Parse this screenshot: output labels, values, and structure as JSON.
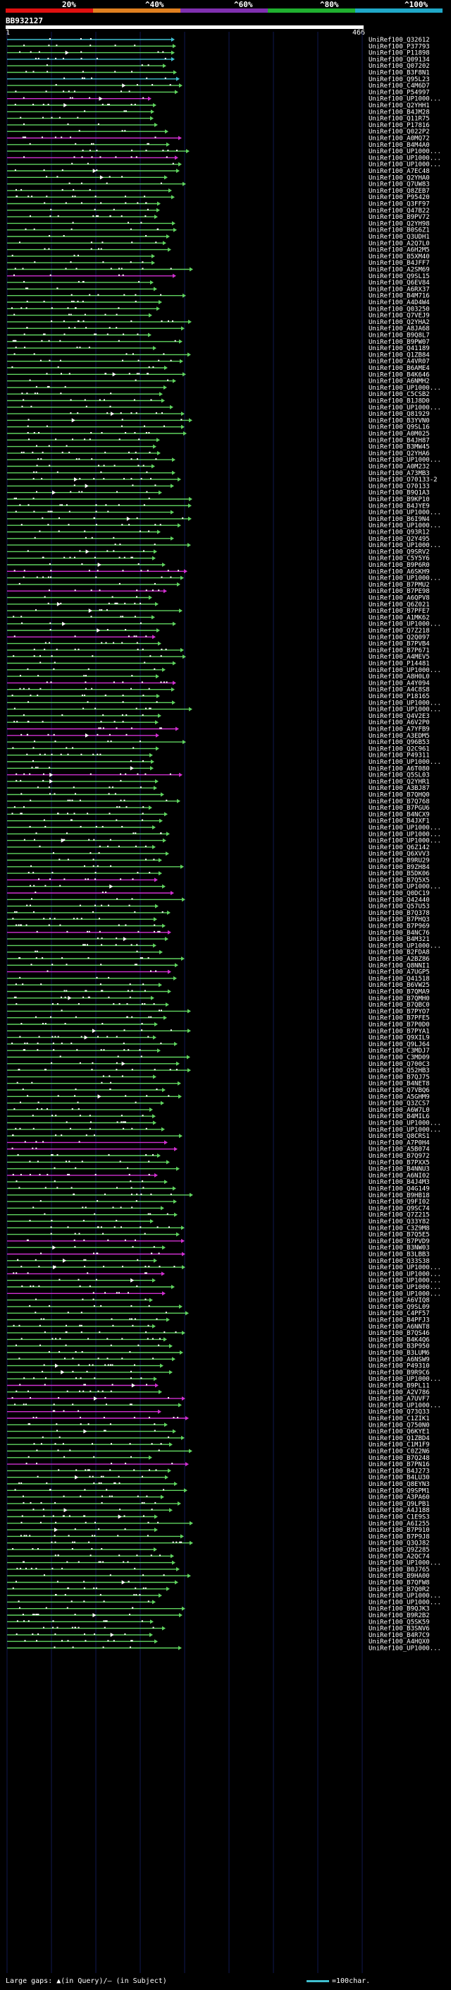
{
  "legend": {
    "labels": [
      "20%",
      "^40%",
      "^60%",
      "^80%",
      "^100%"
    ],
    "colors": [
      "#e01010",
      "#e08020",
      "#8030b0",
      "#20b030",
      "#20a8c8"
    ]
  },
  "query": {
    "id": "BB932127",
    "start": "1",
    "end": "466"
  },
  "hits": [
    "UniRef100_Q32612",
    "UniRef100_P37793",
    "UniRef100_P11898",
    "UniRef100_Q09134",
    "UniRef100_Q07202",
    "UniRef100_B3F8N1",
    "UniRef100_Q95L23",
    "UniRef100_C4M6D7",
    "UniRef100_P54997",
    "UniRef100_UP1000...",
    "UniRef100_Q2YHH1",
    "UniRef100_B4JM28",
    "UniRef100_Q11R75",
    "UniRef100_P17816",
    "UniRef100_Q022P2",
    "UniRef100_A0MQ72",
    "UniRef100_B4M4A0",
    "UniRef100_UP1000...",
    "UniRef100_UP1000...",
    "UniRef100_UP1000...",
    "UniRef100_A7EC48",
    "UniRef100_Q2YHA0",
    "UniRef100_Q7UW83",
    "UniRef100_Q8ZEB7",
    "UniRef100_P95420",
    "UniRef100_Q3FF97",
    "UniRef100_Q47B22",
    "UniRef100_B9PV72",
    "UniRef100_Q2YH98",
    "UniRef100_B0S6Z1",
    "UniRef100_Q3UDH1",
    "UniRef100_A2Q7L0",
    "UniRef100_A6H2M5",
    "UniRef100_B5XM40",
    "UniRef100_B4JFF7",
    "UniRef100_A2SM69",
    "UniRef100_Q9SL15",
    "UniRef100_Q6EV84",
    "UniRef100_A6RX37",
    "UniRef100_B4M716",
    "UniRef100_A4D4W4",
    "UniRef100_Q03250",
    "UniRef100_Q7VEJ9",
    "UniRef100_Q2YHA2",
    "UniRef100_A8JA68",
    "UniRef100_B9Q8L7",
    "UniRef100_B9PW07",
    "UniRef100_Q41189",
    "UniRef100_Q1ZB84",
    "UniRef100_A4VR07",
    "UniRef100_B6AME4",
    "UniRef100_B4K646",
    "UniRef100_A6NMH2",
    "UniRef100_UP1000...",
    "UniRef100_C5CSB2",
    "UniRef100_B1J8D0",
    "UniRef100_UP1000...",
    "UniRef100_Q81929",
    "UniRef100_B3YVN0",
    "UniRef100_Q9SL16",
    "UniRef100_A0M025",
    "UniRef100_B4JH87",
    "UniRef100_B3MW45",
    "UniRef100_Q2YHA6",
    "UniRef100_UP1000...",
    "UniRef100_A0M232",
    "UniRef100_A73MB3",
    "UniRef100_O70133-2",
    "UniRef100_O70133",
    "UniRef100_B9Q1A3",
    "UniRef100_B9KP10",
    "UniRef100_B4JYE9",
    "UniRef100_UP1000...",
    "UniRef100_B6I9N4",
    "UniRef100_UP1000...",
    "UniRef100_Q93R12",
    "UniRef100_Q2Y495",
    "UniRef100_UP1000...",
    "UniRef100_Q9SRV2",
    "UniRef100_C5Y5Y6",
    "UniRef100_B9P6R0",
    "UniRef100_A6SKH9",
    "UniRef100_UP1000...",
    "UniRef100_B7PMU2",
    "UniRef100_B7PE98",
    "UniRef100_A6QPV8",
    "UniRef100_Q6Z021",
    "UniRef100_B7PFE7",
    "UniRef100_A1MK62",
    "UniRef100_UP1000...",
    "UniRef100_Q7Z218",
    "UniRef100_Q2Q097",
    "UniRef100_B7PVB4",
    "UniRef100_B7P671",
    "UniRef100_A4MEV5",
    "UniRef100_P14481",
    "UniRef100_UP1000...",
    "UniRef100_A8H0L0",
    "UniRef100_A4Y094",
    "UniRef100_A4C8S8",
    "UniRef100_P18165",
    "UniRef100_UP1000...",
    "UniRef100_UP1000...",
    "UniRef100_Q4V2E3",
    "UniRef100_A6V2P0",
    "UniRef100_A7YFB9",
    "UniRef100_A3EDM5",
    "UniRef100_Q96B53",
    "UniRef100_Q2C961",
    "UniRef100_P49311",
    "UniRef100_UP1000...",
    "UniRef100_A6T080",
    "UniRef100_Q5SL03",
    "UniRef100_Q2YHR1",
    "UniRef100_A3BJ87",
    "UniRef100_B7QHQ0",
    "UniRef100_B7Q768",
    "UniRef100_B7PGU6",
    "UniRef100_B4NCX9",
    "UniRef100_B4JXF1",
    "UniRef100_UP1000...",
    "UniRef100_UP1000...",
    "UniRef100_UP1000...",
    "UniRef100_Q6Z142",
    "UniRef100_Q6XVV3",
    "UniRef100_B9RU29",
    "UniRef100_B9ZH84",
    "UniRef100_B5DK06",
    "UniRef100_B7Q5X5",
    "UniRef100_UP1000...",
    "UniRef100_Q0DC19",
    "UniRef100_Q42440",
    "UniRef100_Q57U53",
    "UniRef100_B7Q378",
    "UniRef100_B7PHQ3",
    "UniRef100_B7P969",
    "UniRef100_B4NC76",
    "UniRef100_B4M321",
    "UniRef100_UP1000...",
    "UniRef100_B2FDA8",
    "UniRef100_A2BZ86",
    "UniRef100_Q8NNI1",
    "UniRef100_A7UGP5",
    "UniRef100_Q41518",
    "UniRef100_B6VW25",
    "UniRef100_B7QMA9",
    "UniRef100_B7QMH0",
    "UniRef100_B7QBC0",
    "UniRef100_B7PYO7",
    "UniRef100_B7PFE5",
    "UniRef100_B7P0D0",
    "UniRef100_B7PYA1",
    "UniRef100_Q9XIL9",
    "UniRef100_Q9LJ64",
    "UniRef100_C3MDJ7",
    "UniRef100_C3MD09",
    "UniRef100_Q700C3",
    "UniRef100_Q52HB3",
    "UniRef100_B7QJ75",
    "UniRef100_B4NET8",
    "UniRef100_Q7VBQ6",
    "UniRef100_A5GHM9",
    "UniRef100_Q3ZCS7",
    "UniRef100_A6W7L0",
    "UniRef100_B4MIL6",
    "UniRef100_UP1000...",
    "UniRef100_UP1000...",
    "UniRef100_Q8CRS1",
    "UniRef100_A7P0H4",
    "UniRef100_A5B074",
    "UniRef100_B7Q972",
    "UniRef100_B7PXX5",
    "UniRef100_B4NNU3",
    "UniRef100_A6NI02",
    "UniRef100_B4J4M3",
    "UniRef100_Q4G149",
    "UniRef100_B9HB18",
    "UniRef100_Q9FI02",
    "UniRef100_Q9SC74",
    "UniRef100_Q7Z215",
    "UniRef100_Q33Y82",
    "UniRef100_C3Z9M8",
    "UniRef100_B7Q5E5",
    "UniRef100_B7PVD9",
    "UniRef100_B3NW03",
    "UniRef100_B3LBB3",
    "UniRef100_Q33S38",
    "UniRef100_UP1000...",
    "UniRef100_UP1000...",
    "UniRef100_UP1000...",
    "UniRef100_UP1000...",
    "UniRef100_UP1000...",
    "UniRef100_A6VIQ8",
    "UniRef100_Q9SL09",
    "UniRef100_C4PF57",
    "UniRef100_B4PFJ3",
    "UniRef100_A6NNT8",
    "UniRef100_B7QS46",
    "UniRef100_B4K4Q6",
    "UniRef100_B3P950",
    "UniRef100_B3LUM6",
    "UniRef100_A6NSW9",
    "UniRef100_P49310",
    "UniRef100_B9R9C6",
    "UniRef100_UP1000...",
    "UniRef100_B9PL11",
    "UniRef100_A2V786",
    "UniRef100_A7UVF7",
    "UniRef100_UP1000...",
    "UniRef100_Q73Q33",
    "UniRef100_C1ZIK1",
    "UniRef100_Q750N0",
    "UniRef100_Q6KYE1",
    "UniRef100_Q1ZBD4",
    "UniRef100_C1M1F9",
    "UniRef100_C0Z2N6",
    "UniRef100_B7Q248",
    "UniRef100_B7PN16",
    "UniRef100_B4J273",
    "UniRef100_B4LU30",
    "UniRef100_Q8EYN3",
    "UniRef100_Q9SPM1",
    "UniRef100_A3PA60",
    "UniRef100_Q9LPB1",
    "UniRef100_A4J188",
    "UniRef100_C1E9S3",
    "UniRef100_A6I255",
    "UniRef100_B7P910",
    "UniRef100_B7P9J8",
    "UniRef100_Q3QJ82",
    "UniRef100_Q9Z285",
    "UniRef100_A2QC74",
    "UniRef100_UP1000...",
    "UniRef100_B0J765",
    "UniRef100_B9HA00",
    "UniRef100_B7QFW8",
    "UniRef100_B7Q0R2",
    "UniRef100_UP1000...",
    "UniRef100_UP1000...",
    "UniRef100_B9QJK3",
    "UniRef100_B9R2B2",
    "UniRef100_Q5SK59",
    "UniRef100_B3SNV6",
    "UniRef100_B4R7C9",
    "UniRef100_A4HQX0",
    "UniRef100_UP1000..."
  ],
  "footer": {
    "text": "Large gaps: ▲(in Query)/– (in Subject)",
    "scale_label": "=100char."
  }
}
